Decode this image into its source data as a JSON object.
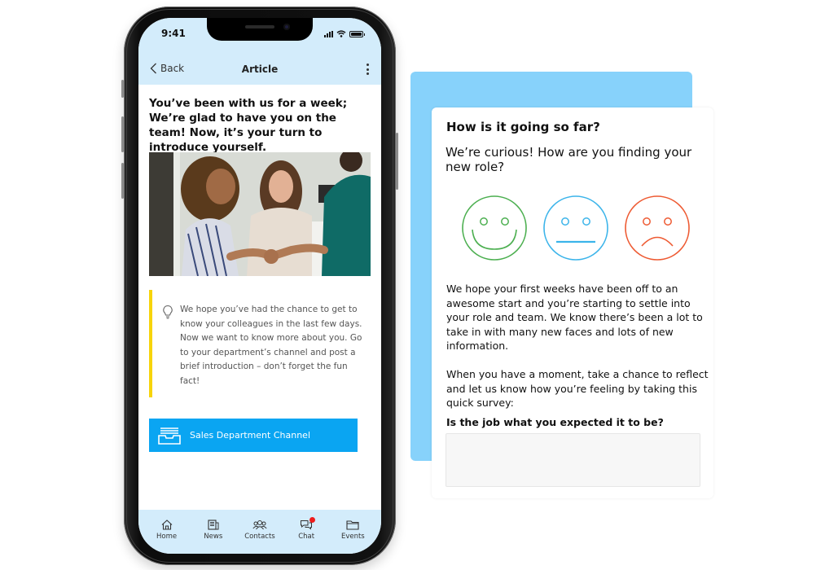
{
  "phone": {
    "status_bar": {
      "time": "9:41",
      "icons": [
        "signal-icon",
        "wifi-icon",
        "battery-icon"
      ]
    },
    "nav": {
      "back_label": "Back",
      "title": "Article",
      "more_icon": "more-vertical-icon"
    },
    "article": {
      "headline": "You’ve been with us for a week; We’re glad to have you on the team! Now, it’s your turn to introduce yourself.",
      "photo_description": "Colleagues smiling and shaking hands",
      "tip": {
        "icon": "lightbulb-icon",
        "accent_color": "#f7d40a",
        "text": "We hope you’ve had the chance to get to know your colleagues in the last few days. Now we want to know more about you. Go to your department’s channel and post a brief introduction – don’t forget the fun fact!"
      },
      "channel_button": {
        "label": "Sales Department Channel",
        "icon": "inbox-tray-icon",
        "color": "#0aa5f2"
      }
    },
    "tabbar": {
      "items": [
        {
          "label": "Home",
          "icon": "home-icon"
        },
        {
          "label": "News",
          "icon": "news-icon"
        },
        {
          "label": "Contacts",
          "icon": "contacts-icon"
        },
        {
          "label": "Chat",
          "icon": "chat-icon",
          "badge": true
        },
        {
          "label": "Events",
          "icon": "folder-icon"
        }
      ]
    }
  },
  "survey": {
    "title": "How is it going so far?",
    "subtitle": "We’re curious! How are you finding your new role?",
    "faces": [
      {
        "mood": "happy",
        "icon": "happy-face-icon",
        "color": "#4caf50"
      },
      {
        "mood": "neutral",
        "icon": "neutral-face-icon",
        "color": "#3bb4ea"
      },
      {
        "mood": "sad",
        "icon": "sad-face-icon",
        "color": "#ee5a32"
      }
    ],
    "body": [
      "We hope your first weeks have been off to an awesome start and you’re starting to settle into your role and team. We know there’s been a lot to take in with many new faces and lots of new information.",
      "When you have a moment, take a chance to reflect and let us know how you’re feeling by taking this quick survey:"
    ],
    "question": {
      "label": "Is the job what you expected it to be?",
      "value": "",
      "placeholder": ""
    },
    "accent_bg": "#87d2fb"
  }
}
